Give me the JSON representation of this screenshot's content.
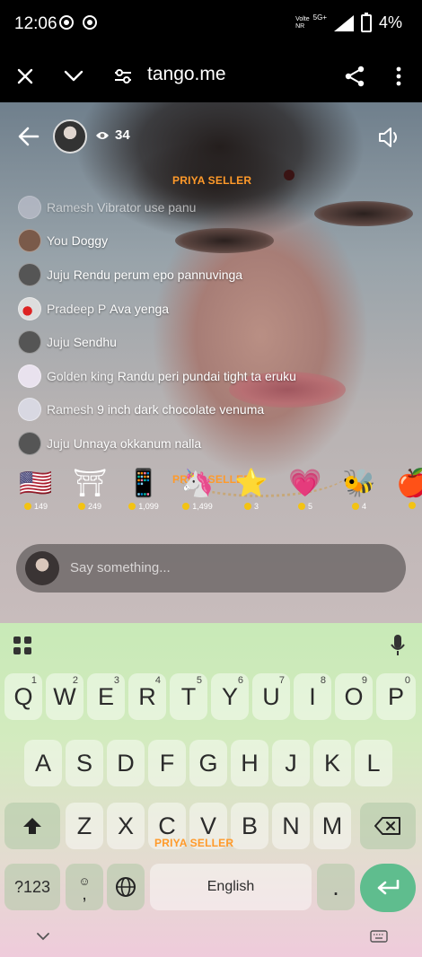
{
  "status": {
    "time": "12:06",
    "network_top": "Volte",
    "network_bottom": "NR",
    "network_type": "5G+",
    "battery": "4%"
  },
  "browser": {
    "url": "tango.me"
  },
  "stream": {
    "viewers": "34",
    "watermark": "PRIYA SELLER",
    "chat": [
      {
        "name": "Ramesh",
        "message": "Vibrator use panu",
        "color": "#c9c9d6"
      },
      {
        "name": "You",
        "message": "Doggy",
        "color": "#7a5a4a"
      },
      {
        "name": "Juju",
        "message": "Rendu perum epo pannuvinga",
        "color": "#555"
      },
      {
        "name": "Pradeep P",
        "message": "Ava yenga",
        "color": "#cfcfcf"
      },
      {
        "name": "Juju",
        "message": "Sendhu",
        "color": "#555"
      },
      {
        "name": "Golden king",
        "message": "Randu peri pundai tight ta eruku",
        "color": "#e9e2ee"
      },
      {
        "name": "Ramesh",
        "message": "9 inch dark chocolate venuma",
        "color": "#d8d8e2"
      },
      {
        "name": "Juju",
        "message": "Unnaya okkanum nalla",
        "color": "#555"
      }
    ],
    "gifts": [
      {
        "icon": "flag-heart-icon",
        "glyph": "🇺🇸",
        "price": "149"
      },
      {
        "icon": "gate-icon",
        "glyph": "⛩",
        "price": "249"
      },
      {
        "icon": "phone-icon",
        "glyph": "📱",
        "price": "1,099"
      },
      {
        "icon": "unicorn-icon",
        "glyph": "🦄",
        "price": "1,499"
      },
      {
        "icon": "star-icon",
        "glyph": "⭐",
        "price": "3"
      },
      {
        "icon": "heart-icon",
        "glyph": "💗",
        "price": "5"
      },
      {
        "icon": "bee-icon",
        "glyph": "🐝",
        "price": "4"
      },
      {
        "icon": "apple-icon",
        "glyph": "🍎",
        "price": ""
      }
    ],
    "say_placeholder": "Say something..."
  },
  "keyboard": {
    "row1": [
      {
        "key": "Q",
        "hint": "1"
      },
      {
        "key": "W",
        "hint": "2"
      },
      {
        "key": "E",
        "hint": "3"
      },
      {
        "key": "R",
        "hint": "4"
      },
      {
        "key": "T",
        "hint": "5"
      },
      {
        "key": "Y",
        "hint": "6"
      },
      {
        "key": "U",
        "hint": "7"
      },
      {
        "key": "I",
        "hint": "8"
      },
      {
        "key": "O",
        "hint": "9"
      },
      {
        "key": "P",
        "hint": "0"
      }
    ],
    "row2": [
      "A",
      "S",
      "D",
      "F",
      "G",
      "H",
      "J",
      "K",
      "L"
    ],
    "row3": [
      "Z",
      "X",
      "C",
      "V",
      "B",
      "N",
      "M"
    ],
    "symbols_label": "?123",
    "comma_label": ",",
    "space_label": "English",
    "period_label": "."
  },
  "colors": {
    "watermark": "#ff9a2a",
    "coin": "#f3c313",
    "enter": "#5fbd8e"
  }
}
